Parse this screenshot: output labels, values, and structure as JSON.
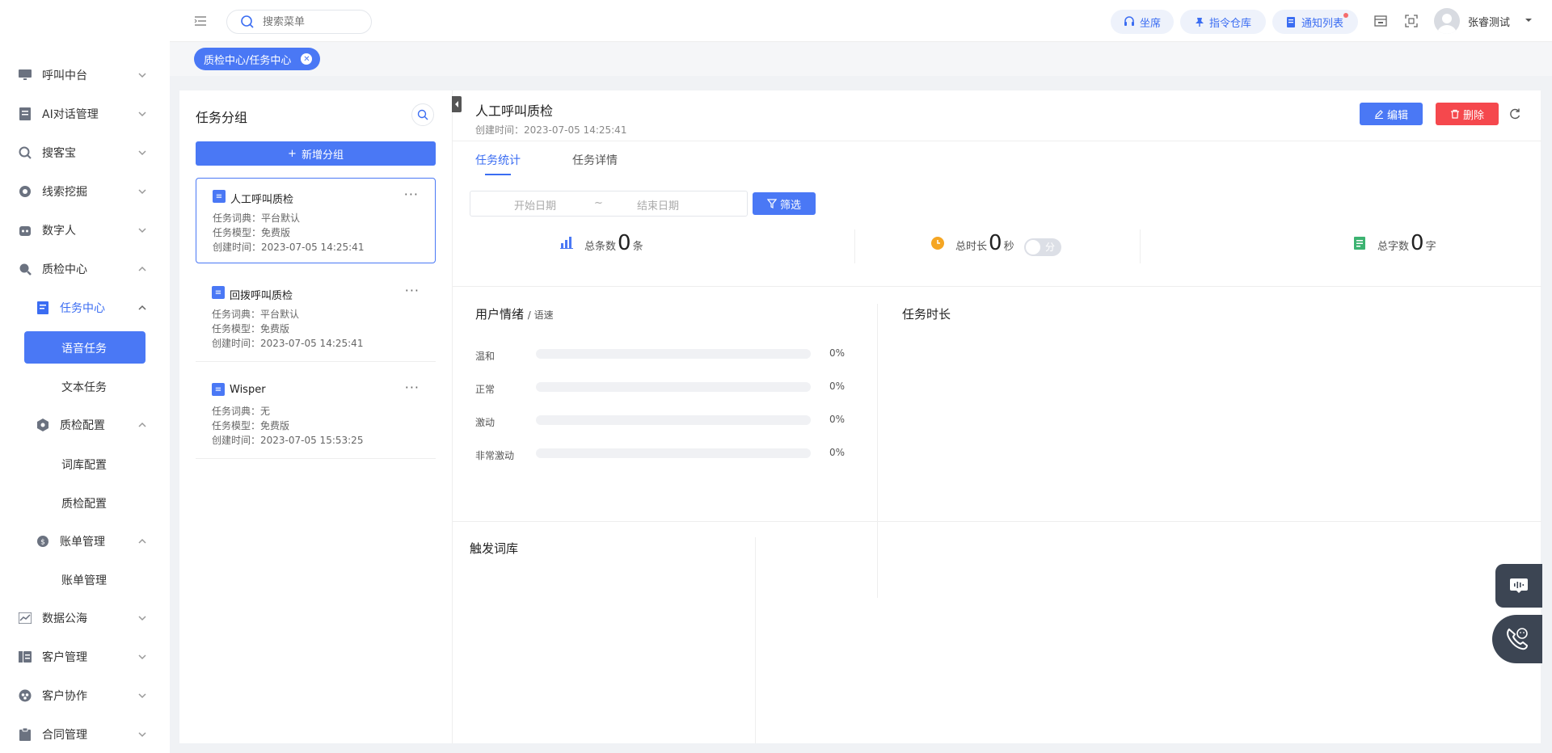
{
  "topbar": {
    "search_placeholder": "搜索菜单",
    "btn_seat": "坐席",
    "btn_command": "指令仓库",
    "btn_notice": "通知列表",
    "username": "张睿测试"
  },
  "tagbar": {
    "tag_label": "质检中心/任务中心"
  },
  "sidebar": {
    "items": [
      {
        "label": "呼叫中台"
      },
      {
        "label": "AI对话管理"
      },
      {
        "label": "搜客宝"
      },
      {
        "label": "线索挖掘"
      },
      {
        "label": "数字人"
      },
      {
        "label": "质检中心"
      },
      {
        "label": "任务中心"
      },
      {
        "label": "语音任务"
      },
      {
        "label": "文本任务"
      },
      {
        "label": "质检配置"
      },
      {
        "label": "词库配置"
      },
      {
        "label": "质检配置"
      },
      {
        "label": "账单管理"
      },
      {
        "label": "账单管理"
      },
      {
        "label": "数据公海"
      },
      {
        "label": "客户管理"
      },
      {
        "label": "客户协作"
      },
      {
        "label": "合同管理"
      }
    ]
  },
  "left_panel": {
    "title": "任务分组",
    "add_label": "新增分组",
    "groups": [
      {
        "name": "人工呼叫质检",
        "dict": "任务词典：平台默认",
        "model": "任务模型：免费版",
        "created": "创建时间：2023-07-05 14:25:41"
      },
      {
        "name": "回拨呼叫质检",
        "dict": "任务词典：平台默认",
        "model": "任务模型：免费版",
        "created": "创建时间：2023-07-05 14:25:41"
      },
      {
        "name": "Wisper",
        "dict": "任务词典：无",
        "model": "任务模型：免费版",
        "created": "创建时间：2023-07-05 15:53:25"
      }
    ]
  },
  "main": {
    "title": "人工呼叫质检",
    "subtitle": "创建时间：2023-07-05 14:25:41",
    "edit_label": "编辑",
    "delete_label": "删除",
    "tabs": [
      {
        "label": "任务统计"
      },
      {
        "label": "任务详情"
      }
    ],
    "date_start": "开始日期",
    "date_sep": "~",
    "date_end": "结束日期",
    "filter_label": "筛选",
    "stats": {
      "total_count_label": "总条数",
      "total_count": "0",
      "total_count_unit": "条",
      "total_duration_label": "总时长",
      "total_duration": "0",
      "total_duration_unit": "秒",
      "toggle_label": "分",
      "total_chars_label": "总字数",
      "total_chars": "0",
      "total_chars_unit": "字"
    },
    "emotion_title": "用户情绪",
    "emotion_sub": "/ 语速",
    "emotions": [
      {
        "label": "温和",
        "value": "0%"
      },
      {
        "label": "正常",
        "value": "0%"
      },
      {
        "label": "激动",
        "value": "0%"
      },
      {
        "label": "非常激动",
        "value": "0%"
      }
    ],
    "duration_title": "任务时长",
    "trigger_title": "触发词库"
  }
}
